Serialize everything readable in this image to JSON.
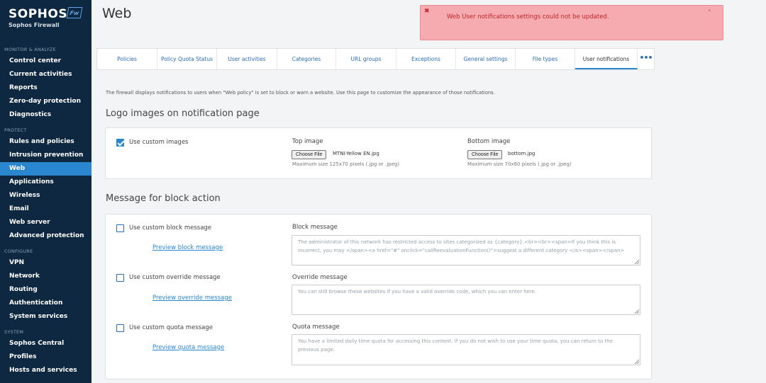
{
  "brand": {
    "name": "SOPHOS",
    "sub": "Sophos Firewall",
    "badge": "Fw"
  },
  "sidebar": {
    "sections": [
      {
        "title": "MONITOR & ANALYZE",
        "items": [
          "Control center",
          "Current activities",
          "Reports",
          "Zero-day protection",
          "Diagnostics"
        ]
      },
      {
        "title": "PROTECT",
        "items": [
          "Rules and policies",
          "Intrusion prevention",
          "Web",
          "Applications",
          "Wireless",
          "Email",
          "Web server",
          "Advanced protection"
        ]
      },
      {
        "title": "CONFIGURE",
        "items": [
          "VPN",
          "Network",
          "Routing",
          "Authentication",
          "System services"
        ]
      },
      {
        "title": "SYSTEM",
        "items": [
          "Sophos Central",
          "Profiles",
          "Hosts and services"
        ]
      }
    ],
    "active": "Web"
  },
  "header": {
    "title": "Web"
  },
  "toast": {
    "message": "Web User notifications settings could not be updated.",
    "icon": "close-icon",
    "color": "#c0262d"
  },
  "tabs": [
    "Policies",
    "Policy Quota Status",
    "User activities",
    "Categories",
    "URL groups",
    "Exceptions",
    "General settings",
    "File types",
    "User notifications"
  ],
  "tabs_more": "•••",
  "active_tab": "User notifications",
  "intro": "The firewall displays notifications to users when \"Web policy\" is set to block or warn a website. Use this page to customize the appearance of those notifications.",
  "logo_section": {
    "title": "Logo images on notification page",
    "use_custom": {
      "label": "Use custom images",
      "checked": true
    },
    "top_image": {
      "label": "Top image",
      "button": "Choose File",
      "file": "MTNI-Yellow EN.jpg",
      "hint": "Maximum size 125x70 pixels (.jpg or .jpeg)"
    },
    "bottom_image": {
      "label": "Bottom image",
      "button": "Choose File",
      "file": "bottom.jpg",
      "hint": "Maximum size 70x60 pixels (.jpg or .jpeg)"
    }
  },
  "block_section": {
    "title": "Message for block action",
    "block": {
      "checkbox": "Use custom block message",
      "preview": "Preview block message",
      "label": "Block message",
      "value": "The administrator of this network has restricted access to sites categorized as {category}.<br><br><span>If you think this is incorrect, you may </span><a href=\"#\" onclick=\"callReevaluationFunction()\">suggest a different category </a><span></span>"
    },
    "override": {
      "checkbox": "Use custom override message",
      "preview": "Preview override message",
      "label": "Override message",
      "value": "You can still browse these websites if you have a valid override code, which you can enter here."
    },
    "quota": {
      "checkbox": "Use custom quota message",
      "preview": "Preview quota message",
      "label": "Quota message",
      "value": "You have a limited daily time quota for accessing this content. If you do not wish to use your time quota, you can return to the previous page."
    }
  },
  "colors": {
    "sidebar": "#0d2840",
    "accent": "#2a86cf",
    "error": "#c0262d"
  }
}
